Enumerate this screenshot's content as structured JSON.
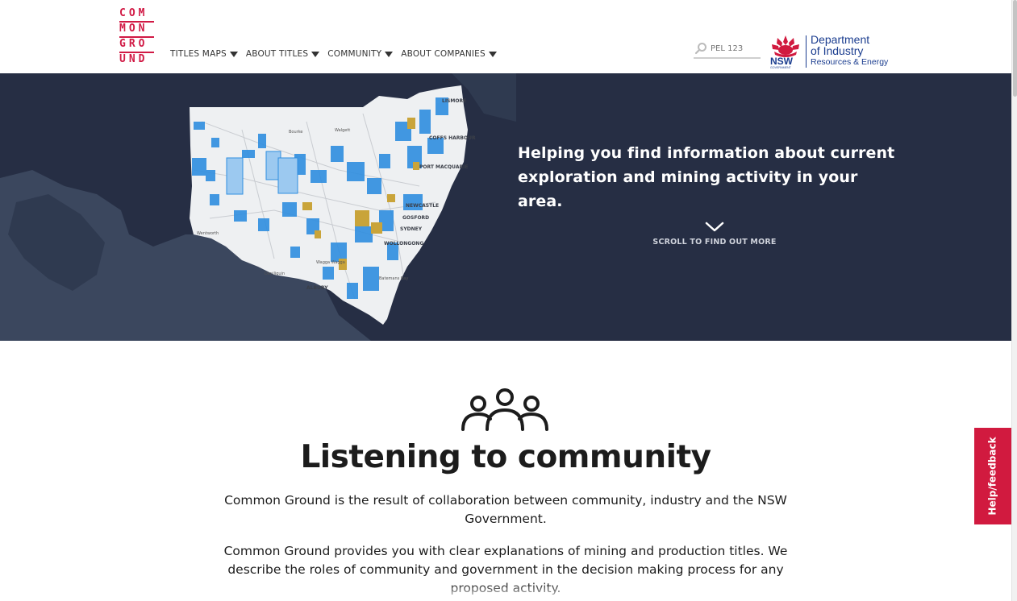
{
  "logo": {
    "lines": [
      "COM",
      "MON",
      "GRO",
      "UND"
    ]
  },
  "nav": {
    "items": [
      {
        "label": "TITLES MAPS"
      },
      {
        "label": "ABOUT TITLES"
      },
      {
        "label": "COMMUNITY"
      },
      {
        "label": "ABOUT COMPANIES"
      }
    ]
  },
  "search": {
    "placeholder": "PEL 123"
  },
  "nsw_logo": {
    "wordmark": "NSW",
    "sub": "GOVERNMENT",
    "line1": "Department",
    "line2": "of Industry",
    "line3": "Resources & Energy"
  },
  "hero": {
    "tagline": "Helping you find information about current exploration and mining activity in your area.",
    "scroll_label": "SCROLL TO FIND OUT MORE",
    "map_labels": [
      "LISMORE",
      "COFFS HARBOUR",
      "PORT MACQUARIE",
      "NEWCASTLE",
      "GOSFORD",
      "SYDNEY",
      "WOLLONGONG",
      "ALBURY",
      "Wentworth",
      "Bourke",
      "Walgett",
      "Wagga Wagga",
      "Deniliquin",
      "Batemans Bay"
    ]
  },
  "section": {
    "title": "Listening to community",
    "para1": "Common Ground is the result of collaboration between community, industry and the NSW Government.",
    "para2": "Common Ground provides you with clear explanations of mining and production titles. We describe the roles of community and government in the decision making process for any proposed activity."
  },
  "feedback": {
    "label": "Help/feedback"
  },
  "colors": {
    "brand_red": "#d11a45",
    "hero_bg": "#262e44",
    "nsw_blue": "#1b3d8f",
    "title_blue": "#2f8ee0",
    "title_gold": "#c9a43a"
  }
}
